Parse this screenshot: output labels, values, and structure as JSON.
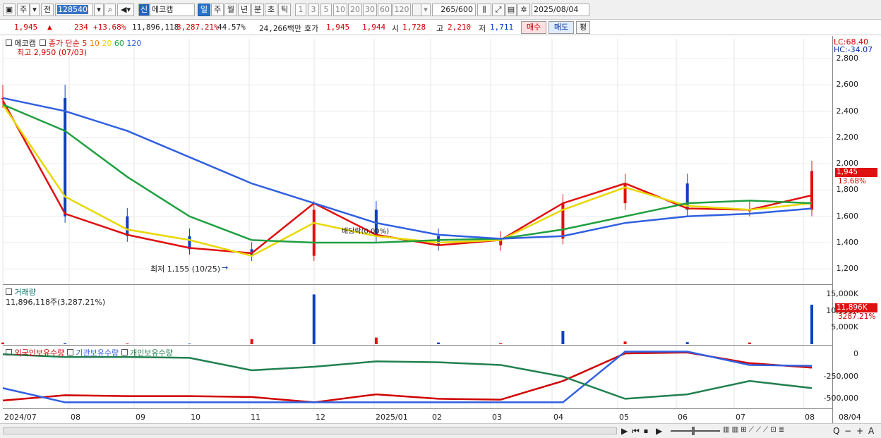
{
  "toolbar": {
    "market": "주",
    "prev": "전",
    "code": "128540",
    "signal": "신",
    "name": "에코캡",
    "periods": [
      "일",
      "주",
      "월",
      "년",
      "분",
      "초",
      "틱"
    ],
    "minutes": [
      "1",
      "3",
      "5",
      "10",
      "20",
      "30",
      "60",
      "120"
    ],
    "count": "265",
    "total": "/600",
    "date": "2025/08/04"
  },
  "quote": {
    "price": "1,945",
    "arrow": "▲",
    "change": "234",
    "pct": "+13.68%",
    "volume": "11,896,118",
    "vol_pct": "3,287.21%",
    "turnover": "44.57%",
    "amount": "24,266백만",
    "ask_label": "호가",
    "ask": "1,945",
    "bid": "1,944",
    "open_label": "시",
    "open": "1,728",
    "high_label": "고",
    "high": "2,210",
    "low_label": "저",
    "low": "1,711",
    "buy": "매수",
    "sell": "매도",
    "eval": "평"
  },
  "price_panel": {
    "legend_name": "에코캡",
    "legend_ma": "종가 단순",
    "ma_periods": [
      "5",
      "10",
      "20",
      "60",
      "120"
    ],
    "ma_colors": [
      "#e01010",
      "#f08000",
      "#e8d800",
      "#20a040",
      "#3060e0"
    ],
    "max_note": "최고 2,950 (07/03)",
    "min_note": "최저 1,155 (10/25)",
    "mid_note": "배당락(0.00%)",
    "lc": "LC:68.40",
    "hc": "HC:-34.07",
    "yticks": [
      "2,800",
      "2,600",
      "2,400",
      "2,200",
      "2,000",
      "1,800",
      "1,600",
      "1,400",
      "1,200"
    ],
    "last_price": "1,945",
    "last_pct": "13.68%"
  },
  "volume_panel": {
    "title": "거래량",
    "value": "11,896,118주(3,287.21%)",
    "yticks": [
      "15,000K",
      "10,000K",
      "5,000K"
    ],
    "last": "11,896K",
    "last_pct": "3287.21%"
  },
  "holder_panel": {
    "l1": "외국인보유수량",
    "l2": "기관보유수량",
    "l3": "개인보유수량",
    "yticks": [
      "0",
      "-250,000",
      "-500,000"
    ]
  },
  "xaxis": [
    "2024/07",
    "08",
    "09",
    "10",
    "11",
    "12",
    "2025/01",
    "02",
    "03",
    "04",
    "05",
    "06",
    "07",
    "08",
    "08/04"
  ],
  "chart_data": [
    {
      "type": "candlestick",
      "title": "에코캡",
      "ylim": [
        1100,
        2950
      ],
      "x": [
        "2024/07",
        "08",
        "09",
        "10",
        "11",
        "12",
        "2025/01",
        "02",
        "03",
        "04",
        "05",
        "06",
        "07",
        "08"
      ],
      "close_approx": [
        2500,
        1600,
        1450,
        1350,
        1300,
        1650,
        1450,
        1380,
        1430,
        1700,
        1850,
        1650,
        1650,
        1945
      ],
      "series": [
        {
          "name": "5",
          "values": [
            2480,
            1620,
            1460,
            1360,
            1320,
            1700,
            1460,
            1380,
            1420,
            1700,
            1850,
            1660,
            1650,
            1760
          ]
        },
        {
          "name": "20",
          "values": [
            2450,
            1750,
            1500,
            1420,
            1300,
            1550,
            1450,
            1400,
            1420,
            1650,
            1820,
            1680,
            1650,
            1700
          ]
        },
        {
          "name": "60",
          "values": [
            2450,
            2250,
            1900,
            1600,
            1420,
            1400,
            1400,
            1420,
            1430,
            1500,
            1600,
            1700,
            1720,
            1700
          ]
        },
        {
          "name": "120",
          "values": [
            2500,
            2400,
            2250,
            2050,
            1850,
            1700,
            1550,
            1460,
            1430,
            1450,
            1550,
            1600,
            1620,
            1660
          ]
        }
      ]
    },
    {
      "type": "bar",
      "title": "거래량",
      "ylim": [
        0,
        17000
      ],
      "values_k": [
        500,
        300,
        200,
        150,
        1500,
        15000,
        2000,
        500,
        300,
        4000,
        800,
        600,
        500,
        11896
      ]
    },
    {
      "type": "line",
      "ylim": [
        -600000,
        50000
      ],
      "series": [
        {
          "name": "외국인보유수량",
          "values": [
            -520000,
            -460000,
            -470000,
            -470000,
            -480000,
            -540000,
            -450000,
            -500000,
            -510000,
            -300000,
            10000,
            20000,
            -100000,
            -150000
          ]
        },
        {
          "name": "기관보유수량",
          "values": [
            -380000,
            -540000,
            -540000,
            -540000,
            -540000,
            -540000,
            -540000,
            -540000,
            -540000,
            -540000,
            30000,
            30000,
            -120000,
            -130000
          ]
        },
        {
          "name": "개인보유수량",
          "values": [
            0,
            -30000,
            -30000,
            -40000,
            -180000,
            -140000,
            -80000,
            -90000,
            -120000,
            -250000,
            -500000,
            -450000,
            -300000,
            -380000
          ]
        }
      ]
    }
  ],
  "scroll": {
    "buttons": [
      "▶",
      "⏮",
      "⏹",
      "▶"
    ],
    "tools": [
      "Q",
      "−",
      "+",
      "A"
    ]
  }
}
